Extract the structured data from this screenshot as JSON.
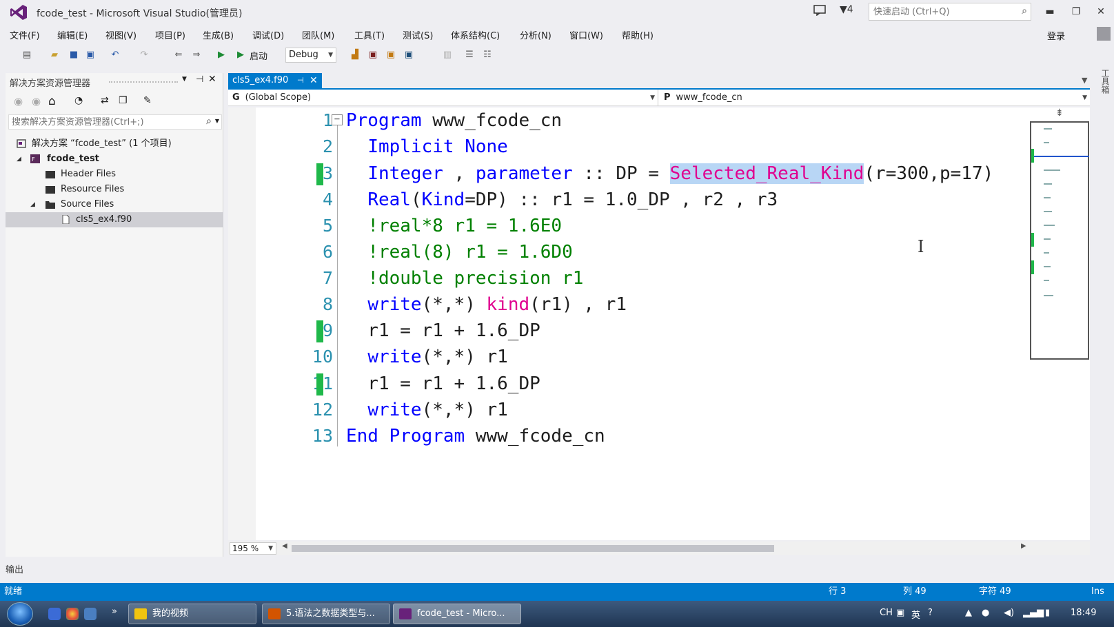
{
  "window": {
    "title": "fcode_test - Microsoft Visual Studio(管理员)",
    "filter_count": "4",
    "quick_launch_placeholder": "快速启动 (Ctrl+Q)",
    "minimize": "▬",
    "restore": "❐",
    "close": "✕"
  },
  "menu": {
    "items": [
      "文件(F)",
      "编辑(E)",
      "视图(V)",
      "项目(P)",
      "生成(B)",
      "调试(D)",
      "团队(M)",
      "工具(T)",
      "测试(S)",
      "体系结构(C)",
      "分析(N)",
      "窗口(W)",
      "帮助(H)"
    ],
    "login": "登录"
  },
  "toolbar": {
    "start_label": "启动",
    "config": "Debug"
  },
  "solution_explorer": {
    "title": "解决方案资源管理器",
    "search_placeholder": "搜索解决方案资源管理器(Ctrl+;)",
    "tree": [
      {
        "label": "解决方案 “fcode_test” (1 个项目)",
        "bold": false
      },
      {
        "label": "fcode_test",
        "bold": true
      },
      {
        "label": "Header Files",
        "bold": false
      },
      {
        "label": "Resource Files",
        "bold": false
      },
      {
        "label": "Source Files",
        "bold": false
      },
      {
        "label": "cls5_ex4.f90",
        "bold": false
      }
    ]
  },
  "editor": {
    "tab_label": "cls5_ex4.f90",
    "scope_left": "(Global Scope)",
    "scope_right": "www_fcode_cn",
    "scope_left_icon": "G",
    "scope_right_icon": "P",
    "zoom": "195 %",
    "line_numbers": [
      "1",
      "2",
      "3",
      "4",
      "5",
      "6",
      "7",
      "8",
      "9",
      "10",
      "11",
      "12",
      "13"
    ]
  },
  "output_tab": "输出",
  "status": {
    "ready": "就绪",
    "row": "行 3",
    "col": "列 49",
    "char": "字符 49",
    "mode": "Ins"
  },
  "taskbar": {
    "buttons": [
      "我的视频",
      "5.语法之数据类型与...",
      "fcode_test - Micro..."
    ],
    "tray_lang": "CH",
    "tray_ime": "英",
    "clock": "18:49"
  },
  "right_rail": "工具箱"
}
